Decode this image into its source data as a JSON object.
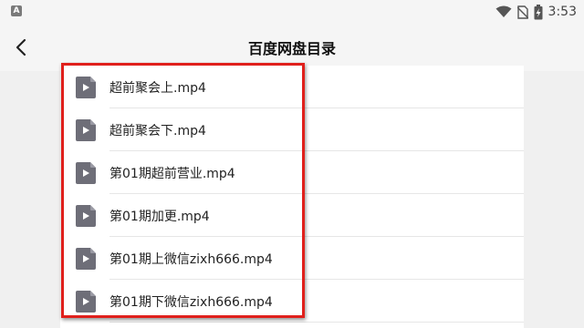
{
  "status_bar": {
    "time": "3:53",
    "icons": [
      "wifi-icon",
      "no-sim-icon",
      "battery-charging-icon"
    ]
  },
  "header": {
    "title": "百度网盘目录",
    "back_icon": "chevron-left-icon"
  },
  "files": [
    {
      "name": "超前聚会上.mp4",
      "icon": "video-file-icon"
    },
    {
      "name": "超前聚会下.mp4",
      "icon": "video-file-icon"
    },
    {
      "name": "第01期超前营业.mp4",
      "icon": "video-file-icon"
    },
    {
      "name": "第01期加更.mp4",
      "icon": "video-file-icon"
    },
    {
      "name": "第01期上微信zixh666.mp4",
      "icon": "video-file-icon"
    },
    {
      "name": "第01期下微信zixh666.mp4",
      "icon": "video-file-icon"
    }
  ],
  "colors": {
    "highlight": "#e0201c",
    "background": "#f0f0f0",
    "list_background": "#ffffff"
  }
}
